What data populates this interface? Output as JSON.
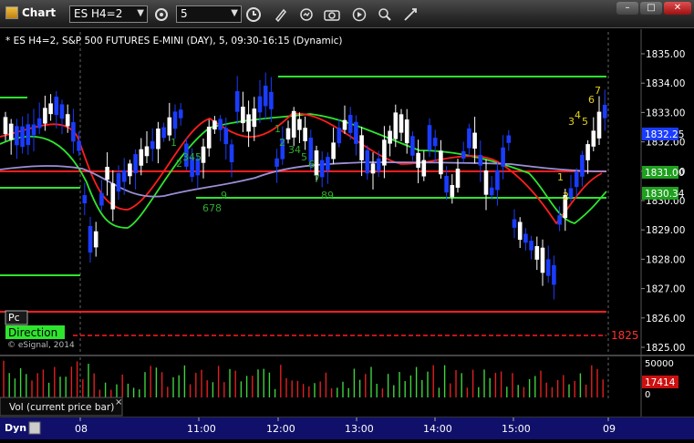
{
  "window": {
    "title": "Chart"
  },
  "toolbar": {
    "symbol": "ES H4=2",
    "interval": "5"
  },
  "chart": {
    "header": "* ES H4=2, S&P 500 FUTURES E-MINI (DAY), 5, 09:30-16:15 (Dynamic)",
    "y_ticks": [
      "1835.00",
      "1834.00",
      "1833.00",
      "1832.00",
      "1831.00",
      "1830.00",
      "1829.00",
      "1828.00",
      "1827.00",
      "1826.00",
      "1825.00"
    ],
    "x_ticks": [
      "08",
      "11:00",
      "12:00",
      "13:00",
      "14:00",
      "15:00",
      "09"
    ],
    "last_price": "1832.25",
    "level_1831": "1831.00",
    "level_1830": "1830.34",
    "level_1825": "1825",
    "copyright": "© eSignal, 2014",
    "pc_label": "Pc",
    "direction_label": "Direction",
    "colors": {
      "up": "#ffffff",
      "down": "#1a3cff",
      "red": "#ff1e1e",
      "green": "#2ee52e",
      "lavender": "#9d8fd6",
      "count_green": "#2faa2f",
      "count_yellow": "#e6d21e"
    }
  },
  "counts": {
    "green": [
      "1",
      "2",
      "345",
      "678",
      "9",
      "1",
      "2",
      "34",
      "5",
      "6",
      "7",
      "89"
    ],
    "yellow": [
      "1",
      "2",
      "3",
      "4",
      "5",
      "6",
      "7"
    ]
  },
  "volume": {
    "axis": [
      "50000",
      "0"
    ],
    "last": "17414",
    "label": "Vol (current price bar)",
    "close": "×"
  },
  "bottom": {
    "dyn": "Dyn"
  }
}
